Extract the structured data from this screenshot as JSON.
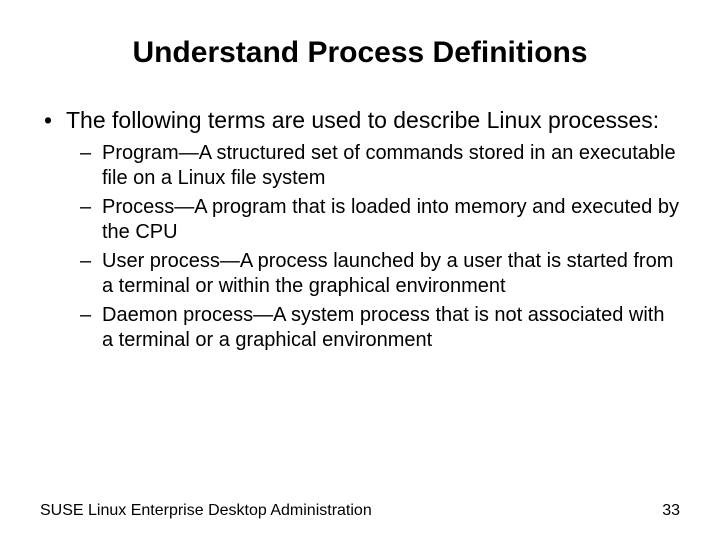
{
  "title": "Understand Process Definitions",
  "intro": "The following terms are used to describe Linux processes:",
  "defs": [
    "Program—A structured set of commands stored in an executable file on a Linux file system",
    "Process—A program that is loaded into memory and executed by the CPU",
    "User process—A process launched by a user that is started from a terminal or within the graphical environment",
    "Daemon process—A system process that is not associated with a terminal or a graphical environment"
  ],
  "footer": {
    "source": "SUSE Linux Enterprise Desktop Administration",
    "page": "33"
  }
}
